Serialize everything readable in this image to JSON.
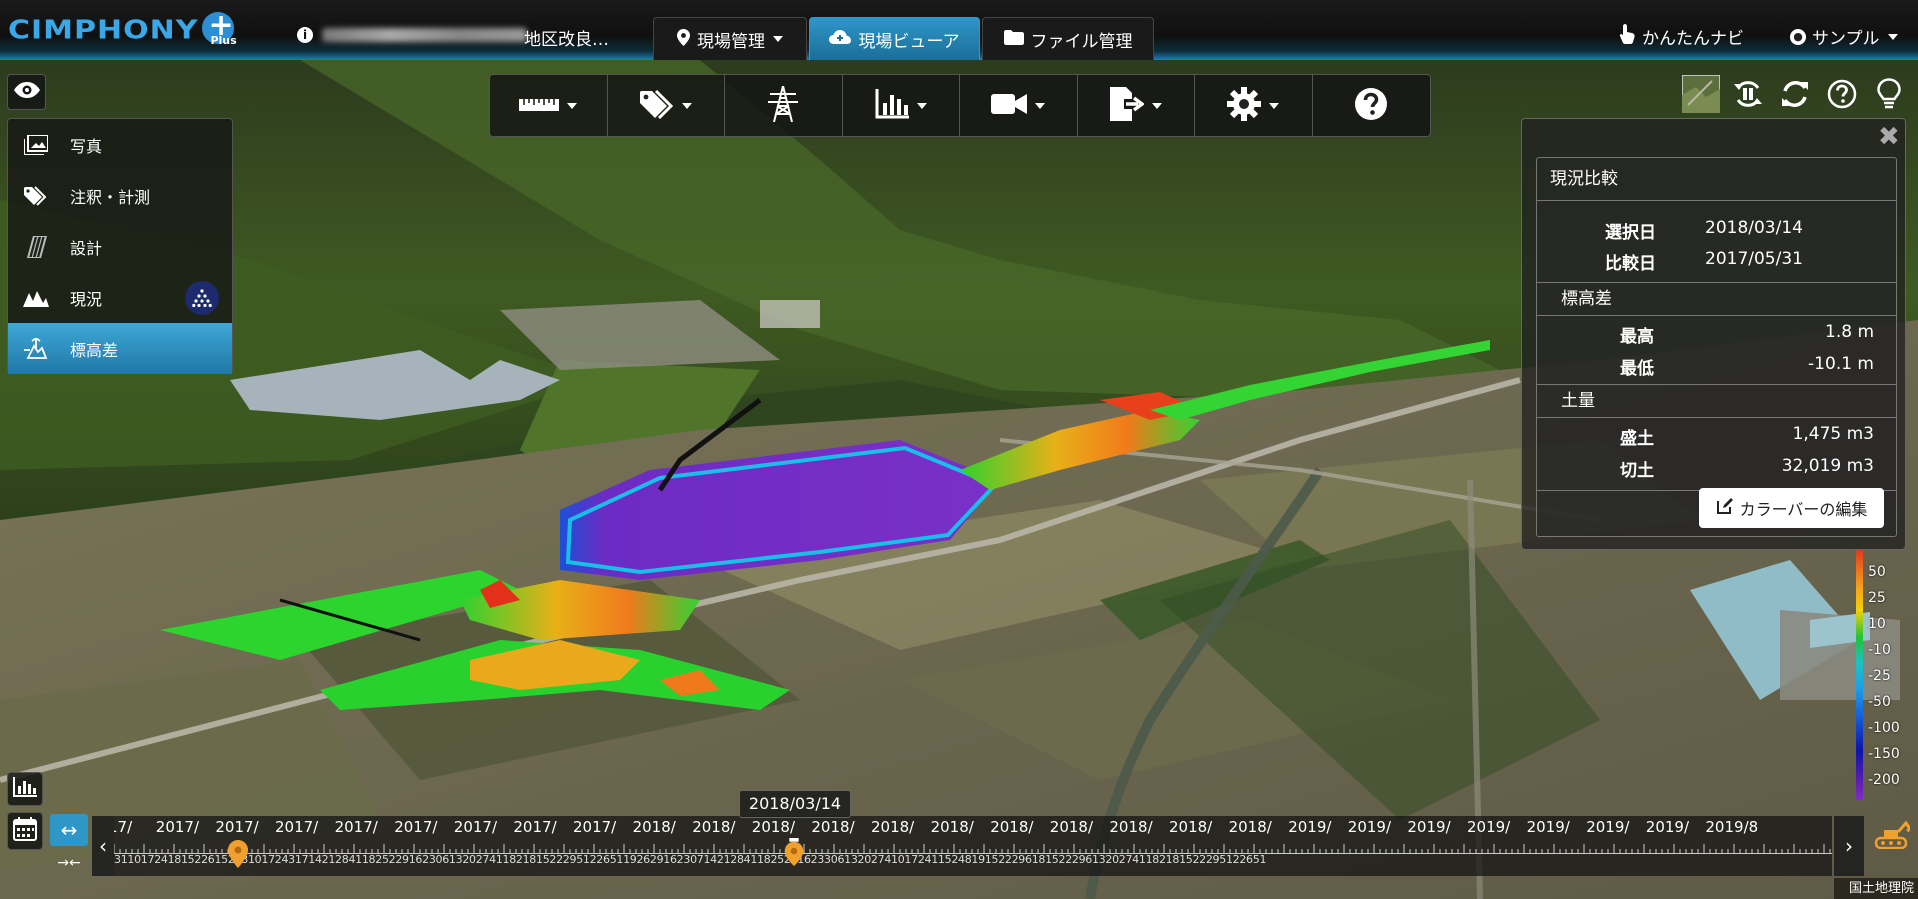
{
  "header": {
    "logo_text": "CIMPHONY",
    "logo_plus": "Plus",
    "site_name": "地区改良…",
    "tabs": [
      {
        "label": "現場管理",
        "icon": "map-marker-icon"
      },
      {
        "label": "現場ビューア",
        "icon": "cloud-icon"
      },
      {
        "label": "ファイル管理",
        "icon": "folder-icon"
      }
    ],
    "navi_label": "かんたんナビ",
    "user_label": "サンプル"
  },
  "layers": [
    {
      "label": "写真",
      "icon": "photo-icon"
    },
    {
      "label": "注釈・計測",
      "icon": "tag-icon"
    },
    {
      "label": "設計",
      "icon": "design-icon"
    },
    {
      "label": "現況",
      "icon": "terrain-icon"
    },
    {
      "label": "標高差",
      "icon": "elevation-diff-icon"
    }
  ],
  "comparison": {
    "title": "現況比較",
    "selected_label": "選択日",
    "selected_value": "2018/03/14",
    "compare_label": "比較日",
    "compare_value": "2017/05/31",
    "elevation_section": "標高差",
    "max_label": "最高",
    "max_value": "1.8 m",
    "min_label": "最低",
    "min_value": "-10.1 m",
    "volume_section": "土量",
    "fill_label": "盛土",
    "fill_value": "1,475 m3",
    "cut_label": "切土",
    "cut_value": "32,019 m3",
    "colorbar_button": "カラーバーの編集"
  },
  "scale": {
    "ticks": [
      "50",
      "25",
      "10",
      "-10",
      "-25",
      "-50",
      "-100",
      "-150",
      "-200"
    ]
  },
  "timeline": {
    "selected_date": "2018/03/14",
    "months": [
      "17/",
      "2017/",
      "2017/",
      "2017/",
      "2017/",
      "2017/",
      "2017/",
      "2017/",
      "2017/",
      "2018/",
      "2018/",
      "2018/",
      "2018/",
      "2018/",
      "2018/",
      "2018/",
      "2018/",
      "2018/",
      "2018/",
      "2018/",
      "2019/",
      "2019/",
      "2019/",
      "2019/",
      "2019/",
      "2019/",
      "2019/",
      "2019/8"
    ],
    "days": "3110172418152261526310172431714212841182522916230613202741182181522295122651192629162307142128411825291623306132027410172411524819152229618152229613202741182181522295122651"
  },
  "attribution": "国土地理院"
}
